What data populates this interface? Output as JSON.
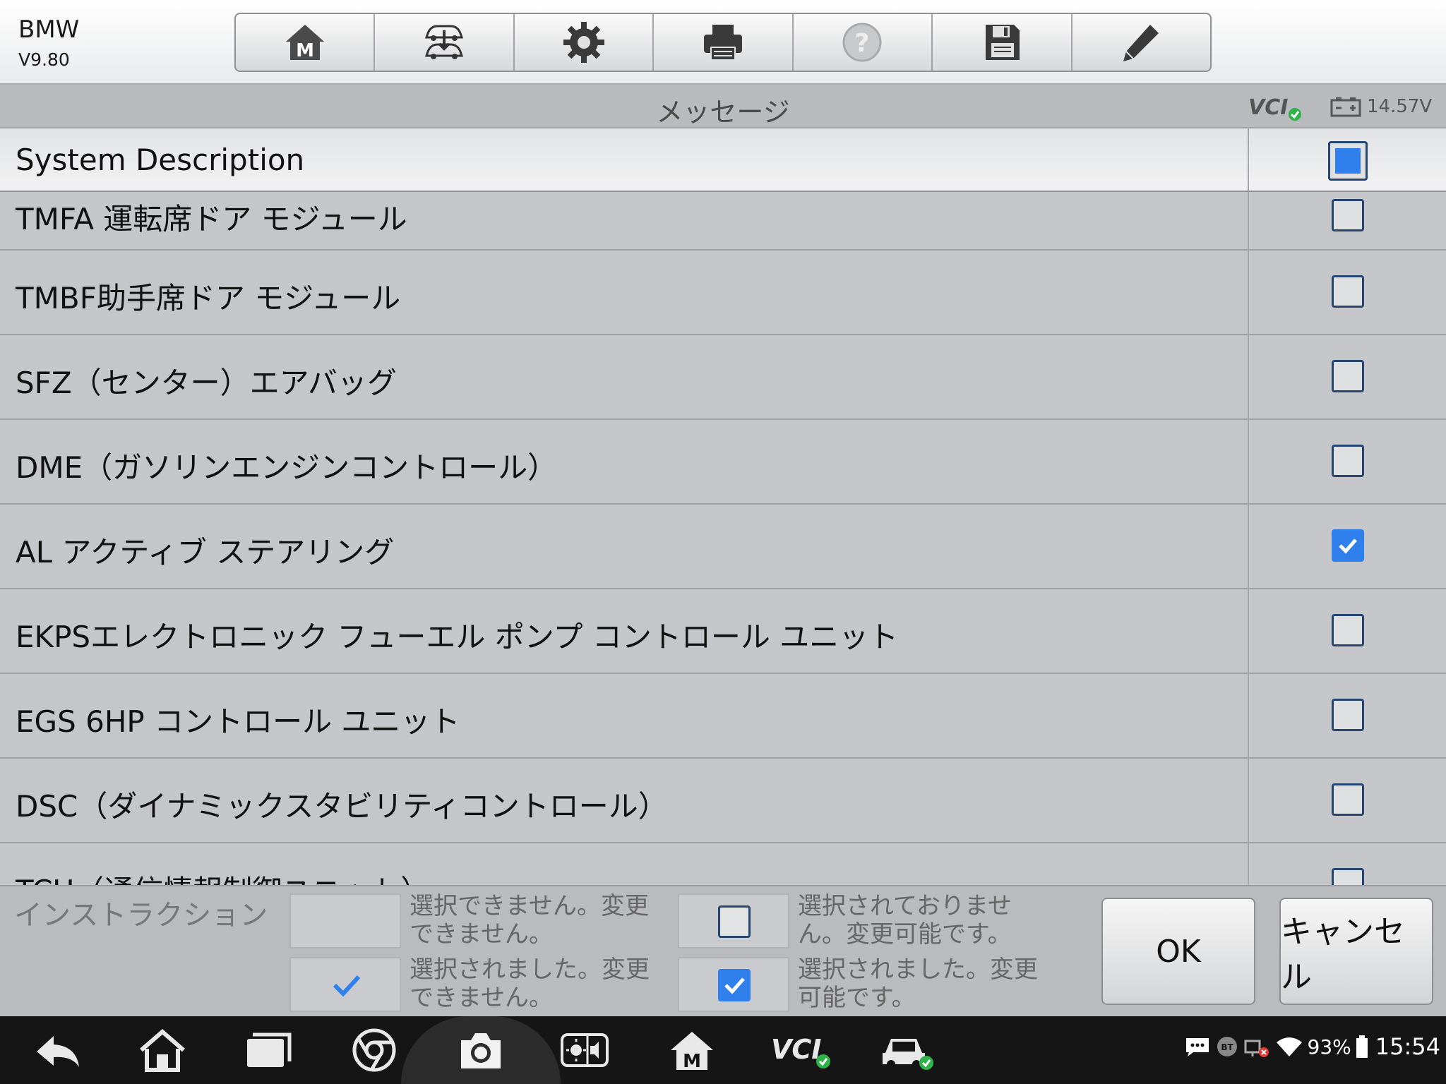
{
  "app": {
    "make": "BMW",
    "version": "V9.80"
  },
  "toolbar": [
    "home-icon",
    "vehicle-swap-icon",
    "gear-icon",
    "printer-icon",
    "help-icon",
    "save-icon",
    "pencil-icon"
  ],
  "titlebar": {
    "title": "メッセージ",
    "vcl": "VCI",
    "voltage": "14.57V"
  },
  "list": {
    "header": {
      "label": "System Description",
      "state": "partial"
    },
    "rows": [
      {
        "label": "TMFA 運転席ドア モジュール",
        "checked": false
      },
      {
        "label": "TMBF助手席ドア モジュール",
        "checked": false
      },
      {
        "label": "SFZ（センター）エアバッグ",
        "checked": false
      },
      {
        "label": "DME（ガソリンエンジンコントロール）",
        "checked": false
      },
      {
        "label": "AL アクティブ ステアリング",
        "checked": true
      },
      {
        "label": "EKPSエレクトロニック フューエル ポンプ コントロール ユニット",
        "checked": false
      },
      {
        "label": "EGS 6HP コントロール ユニット",
        "checked": false
      },
      {
        "label": "DSC（ダイナミックスタビリティコントロール）",
        "checked": false
      },
      {
        "label": "TCU（通信情報制御ユニット）",
        "checked": false
      }
    ]
  },
  "instructions": {
    "title": "インストラクション",
    "legend": [
      {
        "text": "選択できません。変更できません。"
      },
      {
        "text": "選択されておりません。変更可能です。"
      },
      {
        "text": "選択されました。変更できません。"
      },
      {
        "text": "選択されました。変更可能です。"
      }
    ],
    "ok_label": "OK",
    "cancel_label": "キャンセル"
  },
  "status": {
    "battery": "93%",
    "time": "15:54",
    "bt": "BT"
  },
  "colors": {
    "accent": "#2f80ed",
    "border": "#27466f"
  }
}
